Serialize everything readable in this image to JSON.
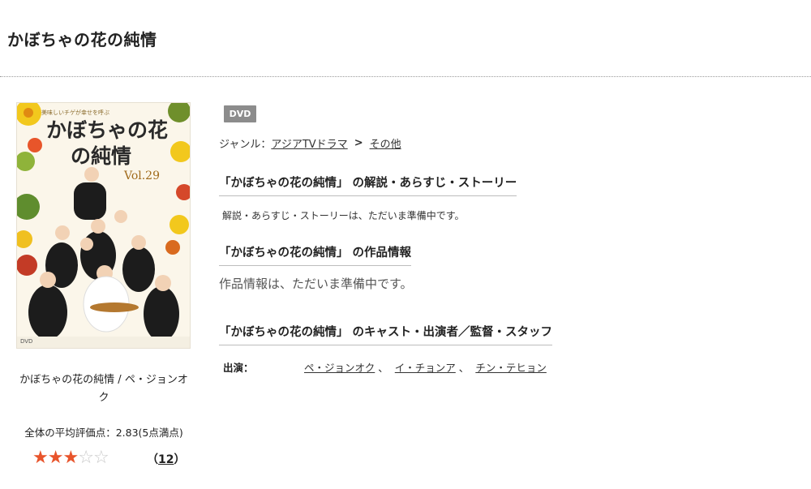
{
  "page": {
    "title": "かぼちゃの花の純情"
  },
  "product": {
    "cover": {
      "tagline": "美味しいチゲが幸せを呼ぶ",
      "title_line1": "かぼちゃの花",
      "title_line2": "の純情",
      "volume": "Vol.29",
      "dvd_mark": "DVD"
    },
    "caption": "かぼちゃの花の純情 / ペ・ジョンオク",
    "average_label": "全体の平均評価点：2.83(5点満点)",
    "rating": {
      "score": 2.83,
      "max": 5,
      "filled_stars": 3,
      "total_stars": 5
    },
    "review_count": "12",
    "review_open": "（",
    "review_close": "）"
  },
  "badge": "DVD",
  "genre": {
    "label": "ジャンル：",
    "links": [
      "アジアTVドラマ",
      "その他"
    ],
    "separator": ">"
  },
  "sections": {
    "synopsis": {
      "heading": "「かぼちゃの花の純情」 の解説・あらすじ・ストーリー",
      "text": "解説・あらすじ・ストーリーは、ただいま準備中です。"
    },
    "info": {
      "heading": "「かぼちゃの花の純情」 の作品情報",
      "text": "作品情報は、ただいま準備中です。"
    },
    "cast": {
      "heading": "「かぼちゃの花の純情」 のキャスト・出演者／監督・スタッフ",
      "label": "出演：",
      "names": [
        "ペ・ジョンオク",
        "イ・チョンア",
        "チン・テヒョン"
      ],
      "separator": "、"
    }
  },
  "colors": {
    "star_filled": "#e8542b",
    "star_empty": "#c9c9c9",
    "badge_bg": "#8c8c8c"
  }
}
